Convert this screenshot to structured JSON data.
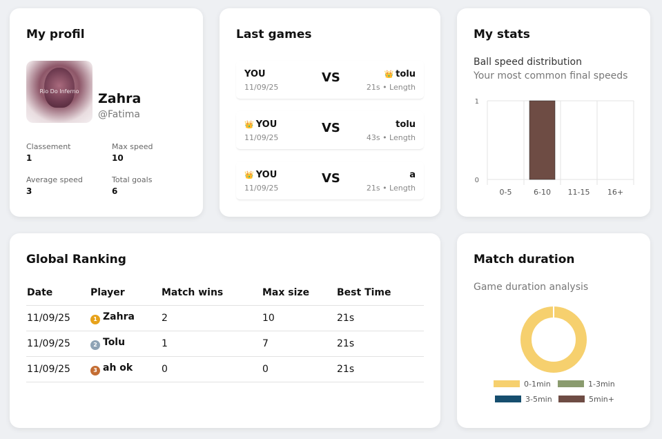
{
  "profile": {
    "title": "My profil",
    "avatar_watermark": "Rio Do Inferno",
    "name": "Zahra",
    "handle": "@Fatima",
    "stats": [
      {
        "label": "Classement",
        "value": "1"
      },
      {
        "label": "Max speed",
        "value": "10"
      },
      {
        "label": "Average speed",
        "value": "3"
      },
      {
        "label": "Total goals",
        "value": "6"
      }
    ]
  },
  "last_games": {
    "title": "Last games",
    "vs_label": "VS",
    "crown_icon": "👑",
    "games": [
      {
        "left": "YOU",
        "left_winner": false,
        "date": "11/09/25",
        "right": "tolu",
        "right_winner": true,
        "detail": "21s • Length"
      },
      {
        "left": "YOU",
        "left_winner": true,
        "date": "11/09/25",
        "right": "tolu",
        "right_winner": false,
        "detail": "43s • Length"
      },
      {
        "left": "YOU",
        "left_winner": true,
        "date": "11/09/25",
        "right": "a",
        "right_winner": false,
        "detail": "21s • Length"
      }
    ]
  },
  "my_stats": {
    "title": "My stats",
    "subtitle": "Ball speed distribution",
    "description": "Your most common final speeds",
    "chart_data": {
      "type": "bar",
      "title": "Ball speed distribution",
      "categories": [
        "0-5",
        "6-10",
        "11-15",
        "16+"
      ],
      "values": [
        0,
        1,
        0,
        0
      ],
      "ylim": [
        0,
        1
      ],
      "yticks": [
        "0",
        "1"
      ],
      "grid": true,
      "bar_color": "#6e4c44"
    }
  },
  "ranking": {
    "title": "Global Ranking",
    "columns": [
      "Date",
      "Player",
      "Match wins",
      "Max size",
      "Best Time"
    ],
    "rows": [
      {
        "date": "11/09/25",
        "medal": "gold-medal-icon",
        "medal_text": "1",
        "medal_color": "#e7a21a",
        "player": "Zahra",
        "wins": "2",
        "max_size": "10",
        "best_time": "21s"
      },
      {
        "date": "11/09/25",
        "medal": "silver-medal-icon",
        "medal_text": "2",
        "medal_color": "#8fa3b5",
        "player": "Tolu",
        "wins": "1",
        "max_size": "7",
        "best_time": "21s"
      },
      {
        "date": "11/09/25",
        "medal": "bronze-medal-icon",
        "medal_text": "3",
        "medal_color": "#c46d33",
        "player": "ah ok",
        "wins": "0",
        "max_size": "0",
        "best_time": "21s"
      }
    ]
  },
  "match_duration": {
    "title": "Match duration",
    "subtitle": "Game duration analysis",
    "chart_data": {
      "type": "pie",
      "labels": [
        "0-1min",
        "1-3min",
        "3-5min",
        "5min+"
      ],
      "values": [
        1,
        0,
        0,
        0
      ],
      "colors": [
        "#f6d06e",
        "#8a9b6e",
        "#164e6e",
        "#6e4c44"
      ],
      "legend": "bottom"
    }
  }
}
